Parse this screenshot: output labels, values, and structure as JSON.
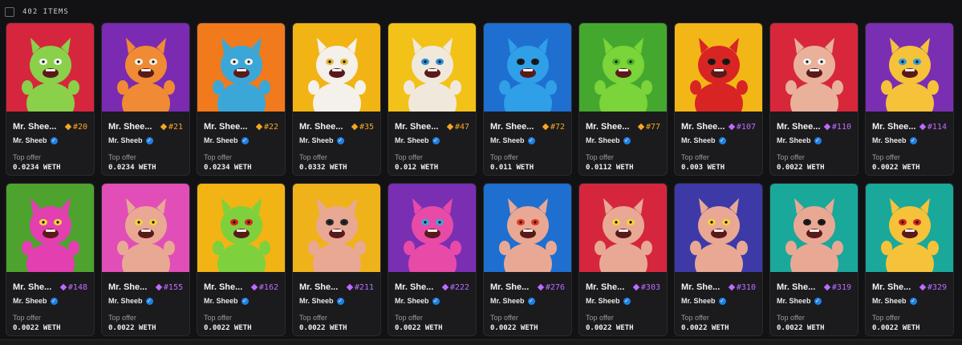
{
  "header": {
    "item_count": "402 ITEMS"
  },
  "colors": {
    "orange": "#f5a623",
    "purple": "#c06bff",
    "verified": "#2081e2"
  },
  "cards": [
    {
      "name": "Mr. Shee...",
      "token": "#20",
      "rarity": "orange",
      "creator": "Mr. Sheeb",
      "offer_label": "Top offer",
      "price": "0.0234 WETH",
      "bg": "#d6263e",
      "body": "#8ad04a",
      "accent": "#f2f2f2"
    },
    {
      "name": "Mr. Shee...",
      "token": "#21",
      "rarity": "orange",
      "creator": "Mr. Sheeb",
      "offer_label": "Top offer",
      "price": "0.0234 WETH",
      "bg": "#7b2ab2",
      "body": "#f08a34",
      "accent": "#f5f0e6"
    },
    {
      "name": "Mr. Shee...",
      "token": "#22",
      "rarity": "orange",
      "creator": "Mr. Sheeb",
      "offer_label": "Top offer",
      "price": "0.0234 WETH",
      "bg": "#f07a1c",
      "body": "#3aa7d8",
      "accent": "#f5f0e6"
    },
    {
      "name": "Mr. Shee...",
      "token": "#35",
      "rarity": "orange",
      "creator": "Mr. Sheeb",
      "offer_label": "Top offer",
      "price": "0.0332 WETH",
      "bg": "#f2b315",
      "body": "#f4f1ea",
      "accent": "#e6b83a"
    },
    {
      "name": "Mr. Shee...",
      "token": "#47",
      "rarity": "orange",
      "creator": "Mr. Sheeb",
      "offer_label": "Top offer",
      "price": "0.012 WETH",
      "bg": "#f2c218",
      "body": "#f1e8dc",
      "accent": "#2d8fd8"
    },
    {
      "name": "Mr. Shee...",
      "token": "#72",
      "rarity": "orange",
      "creator": "Mr. Sheeb",
      "offer_label": "Top offer",
      "price": "0.011 WETH",
      "bg": "#1e6fd0",
      "body": "#2f9fe8",
      "accent": "#1a1a1a"
    },
    {
      "name": "Mr. Shee...",
      "token": "#77",
      "rarity": "orange",
      "creator": "Mr. Sheeb",
      "offer_label": "Top offer",
      "price": "0.0112 WETH",
      "bg": "#45a82e",
      "body": "#7ad43a",
      "accent": "#4fb02a"
    },
    {
      "name": "Mr. Shee...",
      "token": "#107",
      "rarity": "purple",
      "creator": "Mr. Sheeb",
      "offer_label": "Top offer",
      "price": "0.003 WETH",
      "bg": "#f3b617",
      "body": "#d92424",
      "accent": "#1a1a1a"
    },
    {
      "name": "Mr. Shee...",
      "token": "#110",
      "rarity": "purple",
      "creator": "Mr. Sheeb",
      "offer_label": "Top offer",
      "price": "0.0022 WETH",
      "bg": "#d8273b",
      "body": "#e9b09a",
      "accent": "#f2f2f2"
    },
    {
      "name": "Mr. Shee...",
      "token": "#114",
      "rarity": "purple",
      "creator": "Mr. Sheeb",
      "offer_label": "Top offer",
      "price": "0.0022 WETH",
      "bg": "#7a2fb3",
      "body": "#f5c23a",
      "accent": "#2ea0e0"
    },
    {
      "name": "Mr. She...",
      "token": "#148",
      "rarity": "purple",
      "creator": "Mr. Sheeb",
      "offer_label": "Top offer",
      "price": "0.0022 WETH",
      "bg": "#4ea32e",
      "body": "#e33fb0",
      "accent": "#f5d43a"
    },
    {
      "name": "Mr. She...",
      "token": "#155",
      "rarity": "purple",
      "creator": "Mr. Sheeb",
      "offer_label": "Top offer",
      "price": "0.0022 WETH",
      "bg": "#e24eb8",
      "body": "#e8a894",
      "accent": "#f5d43a"
    },
    {
      "name": "Mr. She...",
      "token": "#162",
      "rarity": "purple",
      "creator": "Mr. Sheeb",
      "offer_label": "Top offer",
      "price": "0.0022 WETH",
      "bg": "#f2b315",
      "body": "#7ed13c",
      "accent": "#d92424"
    },
    {
      "name": "Mr. She...",
      "token": "#211",
      "rarity": "purple",
      "creator": "Mr. Sheeb",
      "offer_label": "Top offer",
      "price": "0.0022 WETH",
      "bg": "#f0b21a",
      "body": "#e8a894",
      "accent": "#2a2a2a"
    },
    {
      "name": "Mr. She...",
      "token": "#222",
      "rarity": "purple",
      "creator": "Mr. Sheeb",
      "offer_label": "Top offer",
      "price": "0.0022 WETH",
      "bg": "#7a2fb3",
      "body": "#e84aa8",
      "accent": "#3aa7e0"
    },
    {
      "name": "Mr. She...",
      "token": "#276",
      "rarity": "purple",
      "creator": "Mr. Sheeb",
      "offer_label": "Top offer",
      "price": "0.0022 WETH",
      "bg": "#1e6fd0",
      "body": "#e8a894",
      "accent": "#e33a2a"
    },
    {
      "name": "Mr. She...",
      "token": "#303",
      "rarity": "purple",
      "creator": "Mr. Sheeb",
      "offer_label": "Top offer",
      "price": "0.0022 WETH",
      "bg": "#d6263e",
      "body": "#e8a894",
      "accent": "#f5d43a"
    },
    {
      "name": "Mr. She...",
      "token": "#310",
      "rarity": "purple",
      "creator": "Mr. Sheeb",
      "offer_label": "Top offer",
      "price": "0.0022 WETH",
      "bg": "#3d3aa8",
      "body": "#e8a894",
      "accent": "#f5d43a"
    },
    {
      "name": "Mr. She...",
      "token": "#319",
      "rarity": "purple",
      "creator": "Mr. Sheeb",
      "offer_label": "Top offer",
      "price": "0.0022 WETH",
      "bg": "#1aa89a",
      "body": "#e8a894",
      "accent": "#1a1a1a"
    },
    {
      "name": "Mr. She...",
      "token": "#329",
      "rarity": "purple",
      "creator": "Mr. Sheeb",
      "offer_label": "Top offer",
      "price": "0.0022 WETH",
      "bg": "#1aa89a",
      "body": "#f5c23a",
      "accent": "#d92424"
    }
  ]
}
